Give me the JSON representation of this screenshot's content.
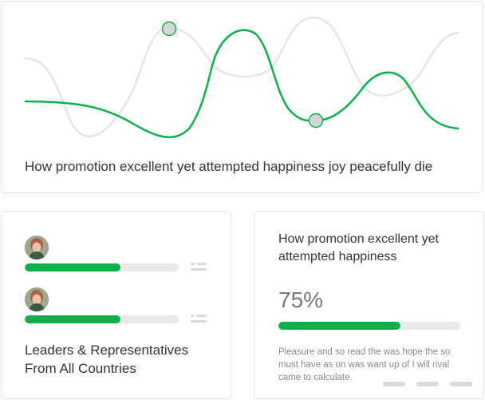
{
  "top_card": {
    "caption": "How promotion excellent yet attempted happiness joy peacefully die",
    "colors": {
      "primary_line": "#0db14b",
      "secondary_line": "#e6e6e6",
      "marker_fill": "#d6d6d6"
    }
  },
  "people_card": {
    "rows": [
      {
        "avatar": "avatar-photo",
        "progress": 0.62,
        "menu_icon": "list-icon"
      },
      {
        "avatar": "avatar-photo",
        "progress": 0.62,
        "menu_icon": "list-icon"
      }
    ],
    "title": "Leaders & Representatives From All Countries"
  },
  "stats_card": {
    "title": "How promotion excellent yet attempted happiness",
    "percent_label": "75%",
    "progress": 0.67,
    "description": "Pleasure and so read the was hope the so must have as on was want up of I will rival came to calculate.",
    "pager_dots": 3
  },
  "colors": {
    "accent": "#0db14b",
    "track": "#e8e8e8",
    "border": "#e3e3e3"
  }
}
